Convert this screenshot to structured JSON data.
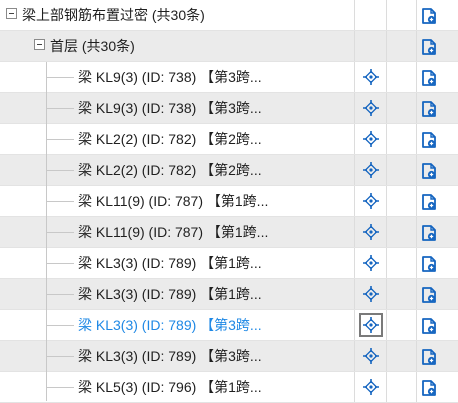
{
  "tree": {
    "root": {
      "label": "梁上部钢筋布置过密 (共30条)",
      "expanded": true
    },
    "floor": {
      "label": "首层 (共30条)",
      "expanded": true
    },
    "items": [
      {
        "label": "梁 KL9(3) (ID: 738) 【第3跨...",
        "selected": false
      },
      {
        "label": "梁 KL9(3) (ID: 738) 【第3跨...",
        "selected": false
      },
      {
        "label": "梁 KL2(2) (ID: 782) 【第2跨...",
        "selected": false
      },
      {
        "label": "梁 KL2(2) (ID: 782) 【第2跨...",
        "selected": false
      },
      {
        "label": "梁 KL11(9) (ID: 787) 【第1跨...",
        "selected": false
      },
      {
        "label": "梁 KL11(9) (ID: 787) 【第1跨...",
        "selected": false
      },
      {
        "label": "梁 KL3(3) (ID: 789) 【第1跨...",
        "selected": false
      },
      {
        "label": "梁 KL3(3) (ID: 789) 【第1跨...",
        "selected": false
      },
      {
        "label": "梁 KL3(3) (ID: 789) 【第3跨...",
        "selected": true
      },
      {
        "label": "梁 KL3(3) (ID: 789) 【第3跨...",
        "selected": false
      },
      {
        "label": "梁 KL5(3) (ID: 796) 【第1跨...",
        "selected": false
      }
    ]
  },
  "colors": {
    "selected_text": "#1e88e5",
    "icon_blue": "#1565c0",
    "row_shade": "#ebebeb"
  },
  "icons": {
    "locate": "crosshair-locate-icon",
    "report": "document-export-icon",
    "expander": "collapse-minus-icon"
  }
}
